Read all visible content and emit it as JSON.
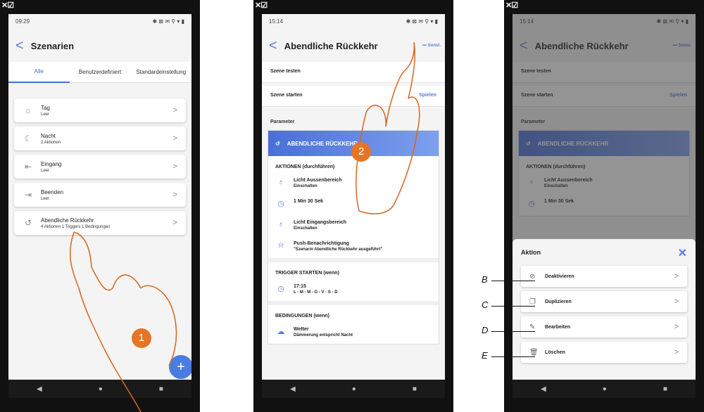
{
  "p1": {
    "time": "09:29",
    "title": "Szenarien",
    "tabs": [
      "Alle",
      "Benutzerdefiniert",
      "Standardeinstellung"
    ],
    "items": [
      {
        "icon": "☼",
        "title": "Tag",
        "sub": "Leer"
      },
      {
        "icon": "☾",
        "title": "Nacht",
        "sub": "2 Aktionen"
      },
      {
        "icon": "⇤",
        "title": "Eingang",
        "sub": "Leer"
      },
      {
        "icon": "⇥",
        "title": "Beenden",
        "sub": "Leer"
      },
      {
        "icon": "↺",
        "title": "Abendliche Rückkehr",
        "sub": "4 Aktionen 1 Triggers 1 Bedingungen"
      }
    ],
    "fab": "+",
    "step": "1"
  },
  "p2": {
    "time": "15:14",
    "title": "Abendliche Rückkehr",
    "more": "••• Sonst.",
    "test": "Szene testen",
    "start": "Szene starten",
    "play": "Spielen",
    "params": "Parameter",
    "scene": "ABENDLICHE RÜCKKEHR",
    "actions_label": "AKTIONEN (durchführen)",
    "actions": [
      {
        "icon": "♁",
        "t": "Licht Aussenbereich",
        "s": "Einschalten"
      },
      {
        "icon": "◷",
        "t": "1 Min 30 Sek",
        "s": ""
      },
      {
        "icon": "♁",
        "t": "Licht Eingangsbereich",
        "s": "Einschalten"
      },
      {
        "icon": "⍾",
        "t": "Push-Benachrichtigung",
        "s": "\"Szenario Abendliche Rückkehr ausgeführt\""
      }
    ],
    "trigger_label": "TRIGGER STARTEN (wenn)",
    "trigger": {
      "icon": "◷",
      "t": "17:15",
      "s": "L - M - M - G - V - S - D"
    },
    "cond_label": "BEDINGUNGEN (wenn)",
    "cond": {
      "icon": "☁",
      "t": "Wetter",
      "s": "Dämmerung entspricht Nacht"
    },
    "step": "2"
  },
  "p3": {
    "sheet_title": "Aktion",
    "close": "✕",
    "options": [
      {
        "icon": "⊘",
        "t": "Deaktivieren",
        "letter": "B"
      },
      {
        "icon": "❐",
        "t": "Duplizieren",
        "letter": "C"
      },
      {
        "icon": "✎",
        "t": "Bearbeiten",
        "letter": "D"
      },
      {
        "icon": "🗑",
        "t": "Löschen",
        "letter": "E"
      }
    ]
  },
  "common": {
    "nav": [
      "◀",
      "●",
      "■"
    ],
    "corner": "✕☑",
    "status_right": "✱ ⊠ ✉ ⚲ ▾ ▮"
  }
}
